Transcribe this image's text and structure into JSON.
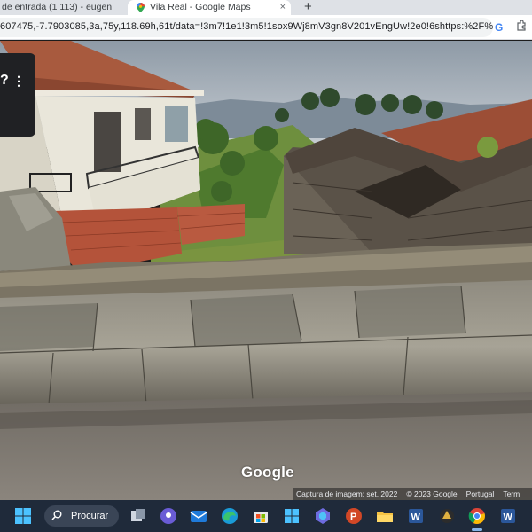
{
  "browser": {
    "tabs": [
      {
        "title": "de entrada (1 113) - eugen"
      },
      {
        "title": "Vila Real - Google Maps",
        "close": "×"
      }
    ],
    "new_tab": "+",
    "url": "607475,-7.7903085,3a,75y,118.69h,61t/data=!3m7!1e1!3m5!1sox9Wj8mV3gn8V201vEngUw!2e0!6shttps:%2F%2...",
    "google_icon": "G"
  },
  "maps": {
    "side_panel_glyph": "?",
    "side_menu": "⋮",
    "watermark": "Google",
    "image_capture": "Captura de imagem: set. 2022",
    "copyright": "© 2023 Google",
    "language": "Portugal",
    "terms": "Term"
  },
  "taskbar": {
    "search_label": "Procurar",
    "apps": [
      "start-icon",
      "search-icon",
      "task-view-icon",
      "chat-icon",
      "mail-icon",
      "edge-icon",
      "store-icon",
      "windows-icon",
      "copilot-icon",
      "powerpoint-icon",
      "file-explorer-icon",
      "word-icon",
      "app-icon",
      "chrome-icon",
      "word-icon"
    ]
  },
  "colors": {
    "tab_bar": "#dee1e6",
    "taskbar": "#1f2a3a",
    "accent": "#86b4e8"
  }
}
